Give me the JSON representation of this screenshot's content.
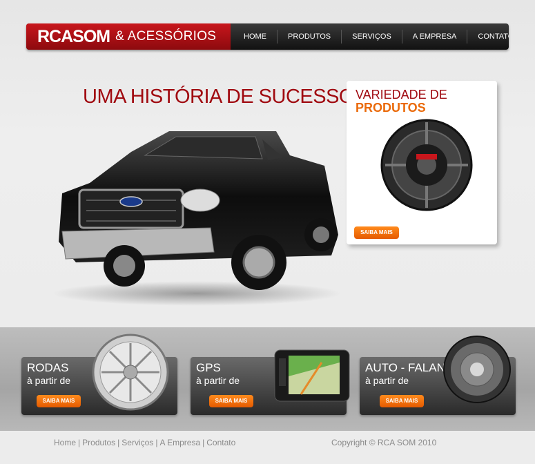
{
  "header": {
    "brand": "RCASOM",
    "brand_sub": "& ACESSÓRIOS",
    "nav": [
      "HOME",
      "PRODUTOS",
      "SERVIÇOS",
      "A EMPRESA",
      "CONTATO"
    ]
  },
  "hero": {
    "title": "UMA HISTÓRIA DE SUCESSO"
  },
  "promo": {
    "line1": "VARIEDADE DE",
    "line2": "PRODUTOS",
    "button": "SAIBA MAIS"
  },
  "cards": [
    {
      "title": "RODAS",
      "subtitle": "à partir de",
      "button": "SAIBA MAIS"
    },
    {
      "title": "GPS",
      "subtitle": "à partir de",
      "button": "SAIBA MAIS"
    },
    {
      "title": "AUTO - FALANTE",
      "subtitle": "à partir de",
      "button": "SAIBA MAIS"
    }
  ],
  "footer": {
    "links": [
      "Home",
      "Produtos",
      "Serviços",
      "A Empresa",
      "Contato"
    ],
    "copyright": "Copyright © RCA SOM 2010"
  },
  "colors": {
    "brand_red": "#a00a10",
    "accent_orange": "#ea6a0a"
  }
}
